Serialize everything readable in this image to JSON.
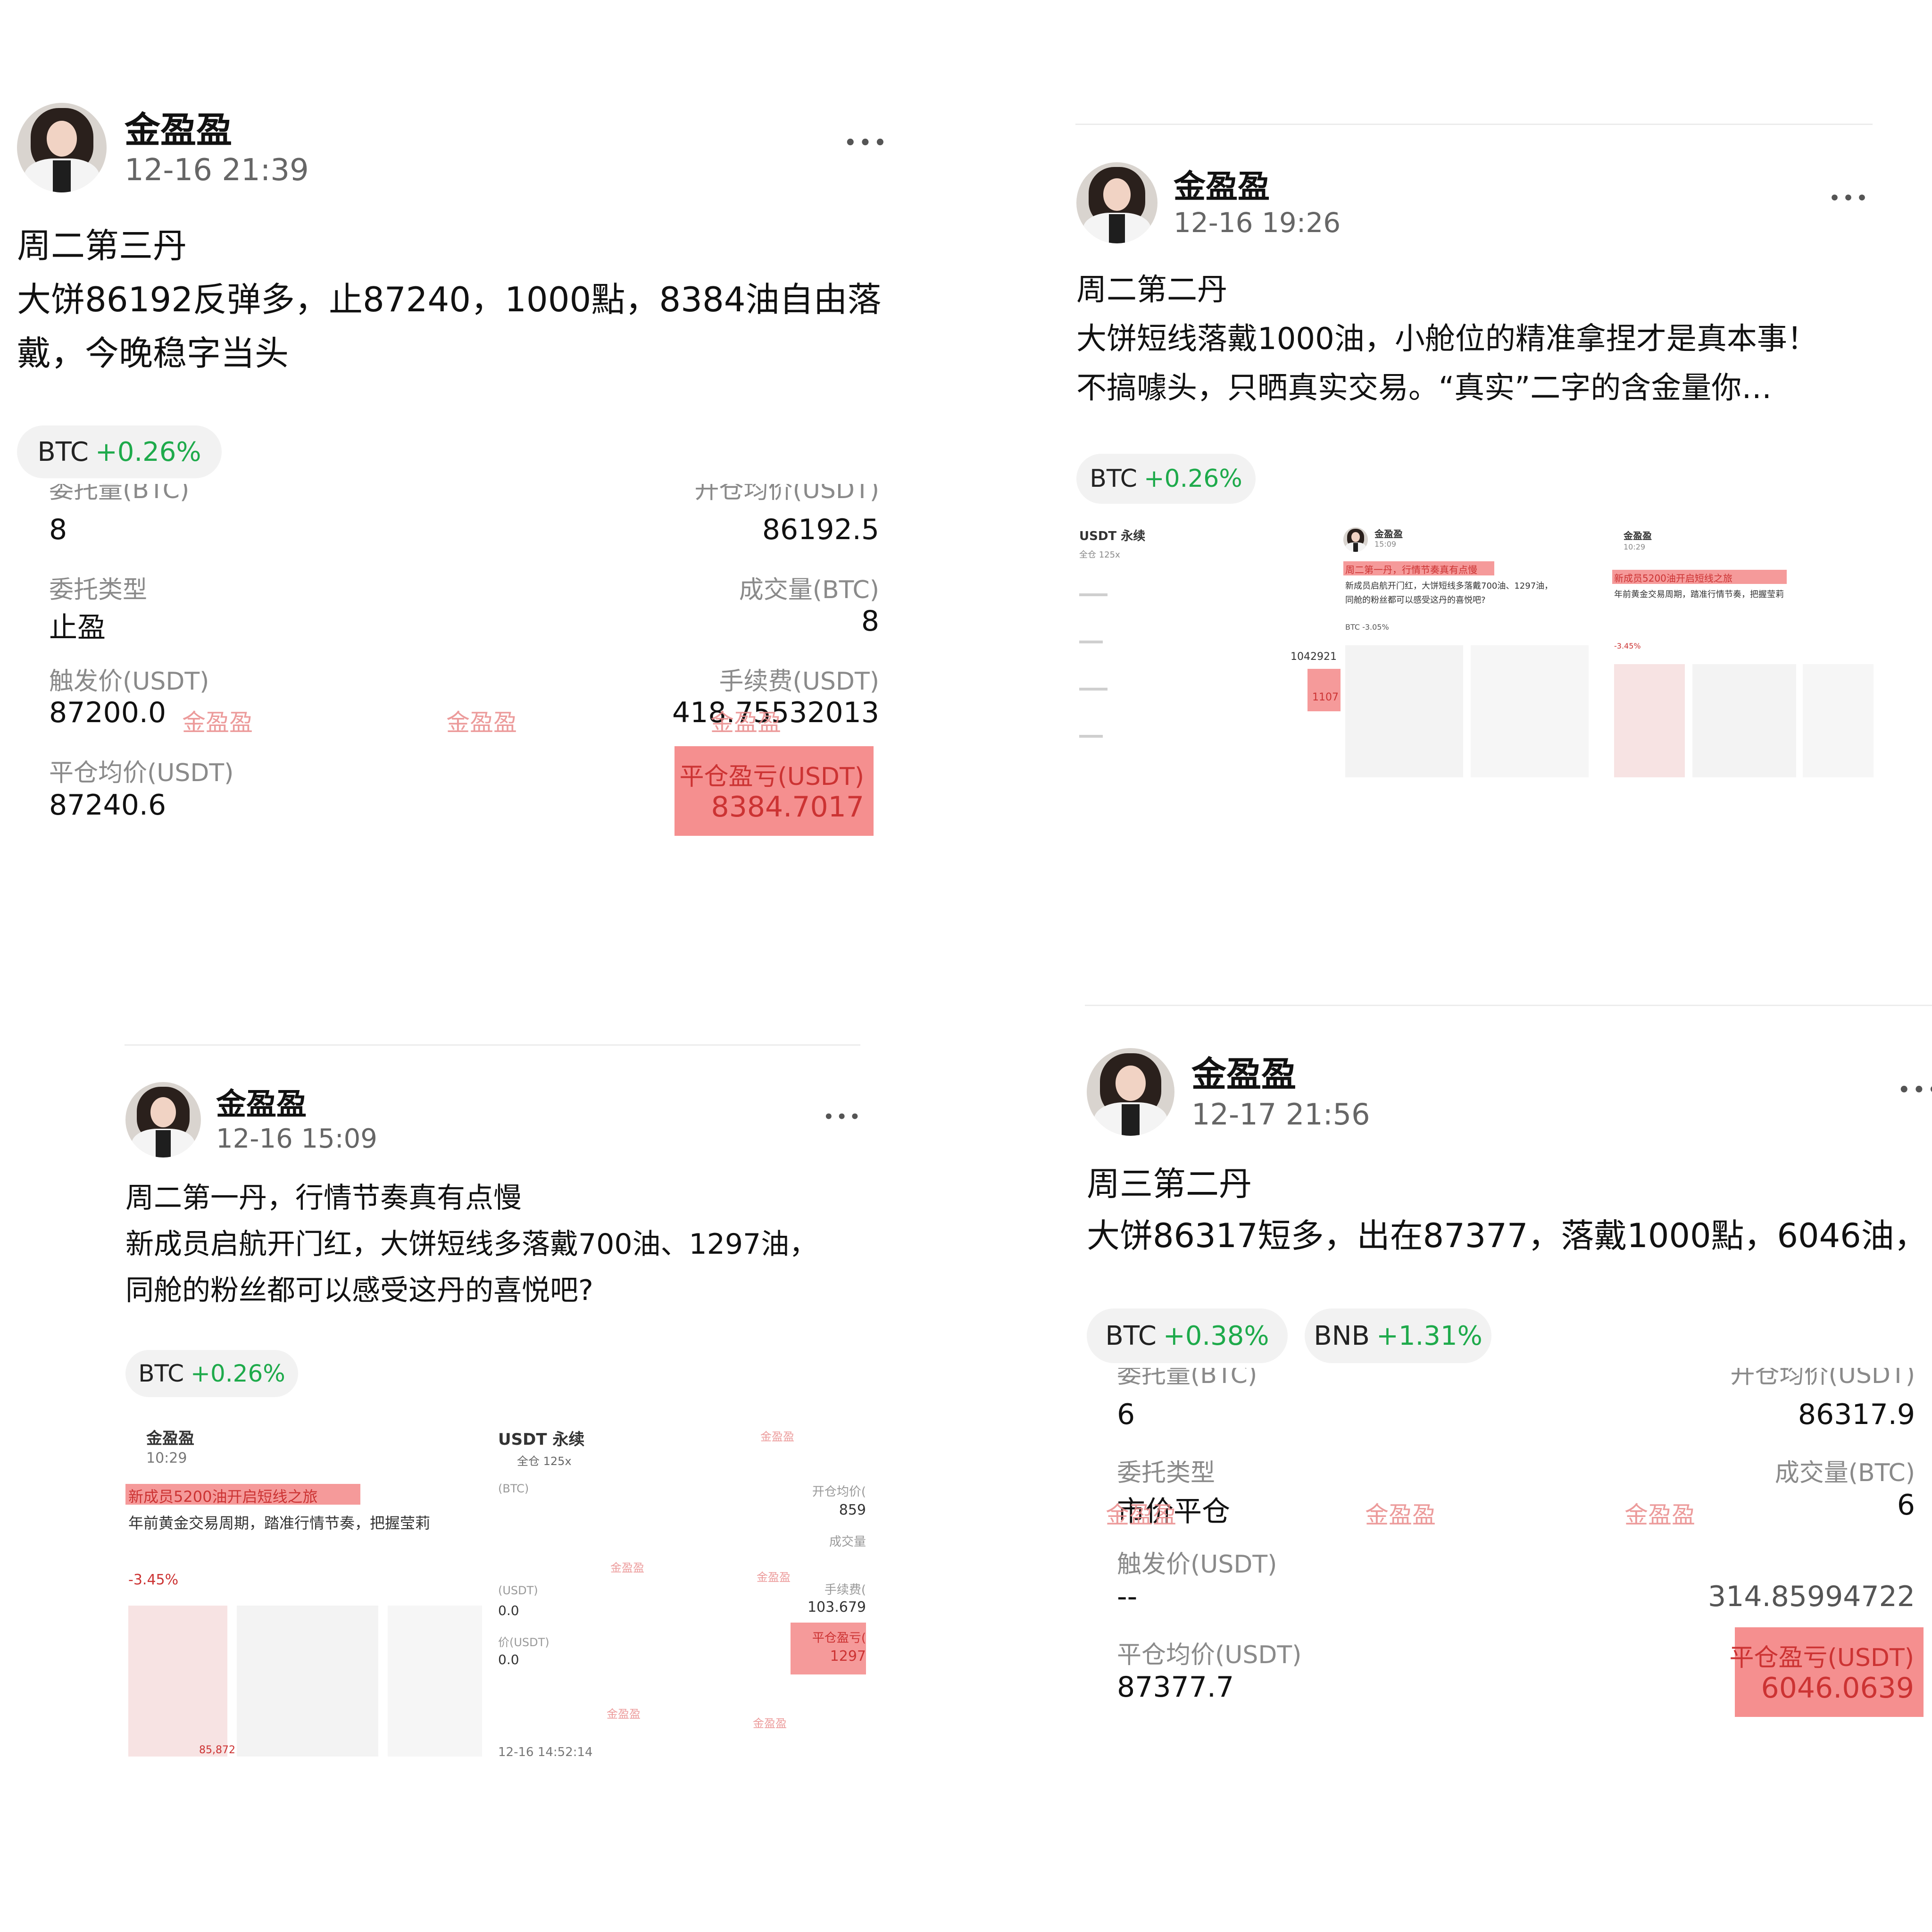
{
  "posts": [
    {
      "author": "金盈盈",
      "time": "12-16 21:39",
      "more": "•••",
      "lines": [
        "周二第三丹",
        "大饼86192反弹多，止87240，1000點，8384油自由落",
        "戴，今晚稳字当头"
      ],
      "tags": [
        {
          "symbol": "BTC",
          "change": "+0.26%"
        }
      ],
      "card": {
        "order_qty_label": "委托量(BTC)",
        "order_qty": "8",
        "open_avg_label": "开仓均价(USDT)",
        "open_avg": "86192.5",
        "order_type_label": "委托类型",
        "order_type": "止盈",
        "filled_label": "成交量(BTC)",
        "filled": "8",
        "trigger_label": "触发价(USDT)",
        "trigger": "87200.0",
        "fee_label": "手续费(USDT)",
        "fee": "418.75532013",
        "close_avg_label": "平仓均价(USDT)",
        "close_avg": "87240.6",
        "pnl_label": "平仓盈亏(USDT)",
        "pnl": "8384.7017",
        "watermark": "金盈盈"
      }
    },
    {
      "author": "金盈盈",
      "time": "12-16 19:26",
      "more": "•••",
      "lines": [
        "周二第二丹",
        "大饼短线落戴1000油，小舱位的精准拿捏才是真本事！",
        "不搞噱头，只晒真实交易。“真实”二字的含金量你…"
      ],
      "tags": [
        {
          "symbol": "BTC",
          "change": "+0.26%"
        }
      ],
      "thumbs": {
        "t1_title": "USDT 永续",
        "t1_sub": "全仓 125x",
        "t1_value": "1042921",
        "t1_pnl": "1107",
        "t2_author": "金盈盈",
        "t2_time": "15:09",
        "t2_banner": "周二第一丹，行情节奏真有点慢",
        "t2_text": "新成员启航开门红，大饼短线多落戴700油、1297油，",
        "t2_text2": "同舱的粉丝都可以感受这丹的喜悦吧?",
        "t2_change": "BTC -3.05%",
        "t3_author": "金盈盈",
        "t3_time": "10:29",
        "t3_banner": "新成员5200油开启短线之旅",
        "t3_text": "年前黄金交易周期，踏准行情节奏，把握莹莉",
        "t3_change": "-3.45%"
      }
    },
    {
      "author": "金盈盈",
      "time": "12-16 15:09",
      "more": "•••",
      "lines": [
        "周二第一丹，行情节奏真有点慢",
        "新成员启航开门红，大饼短线多落戴700油、1297油，",
        "同舱的粉丝都可以感受这丹的喜悦吧?"
      ],
      "tags": [
        {
          "symbol": "BTC",
          "change": "+0.26%"
        }
      ],
      "thumbs": {
        "a_author": "金盈盈",
        "a_time": "10:29",
        "a_banner": "新成员5200油开启短线之旅",
        "a_text": "年前黄金交易周期，踏准行情节奏，把握莹莉",
        "a_change": "-3.45%",
        "a_price": "85,872",
        "b_title": "USDT 永续",
        "b_sub": "全仓 125x",
        "b_open_label": "开仓均价(",
        "b_open": "859",
        "b_filled_label": "成交量",
        "b_fee_label": "手续费(",
        "b_fee": "103.679",
        "b_pnl_label": "平仓盈亏(",
        "b_pnl": "1297",
        "b_time": "12-16 14:52:14",
        "b_val1": "0.0",
        "b_val2": "0.0",
        "b_usdt": "(USDT)",
        "b_avg": "价(USDT)",
        "b_btc": "(BTC)",
        "watermark": "金盈盈"
      }
    },
    {
      "author": "金盈盈",
      "time": "12-17 21:56",
      "more": "•••",
      "lines": [
        "周三第二丹",
        "大饼86317短多，出在87377，落戴1000點，6046油，"
      ],
      "tags": [
        {
          "symbol": "BTC",
          "change": "+0.38%"
        },
        {
          "symbol": "BNB",
          "change": "+1.31%"
        }
      ],
      "card": {
        "order_qty_label": "委托量(BTC)",
        "order_qty": "6",
        "open_avg_label": "开仓均价(USDT)",
        "open_avg": "86317.9",
        "order_type_label": "委托类型",
        "order_type": "市价平仓",
        "filled_label": "成交量(BTC)",
        "filled": "6",
        "trigger_label": "触发价(USDT)",
        "trigger": "--",
        "fee": "314.85994722",
        "close_avg_label": "平仓均价(USDT)",
        "close_avg": "87377.7",
        "pnl_label": "平仓盈亏(USDT)",
        "pnl": "6046.0639",
        "watermark": "金盈盈"
      }
    }
  ]
}
